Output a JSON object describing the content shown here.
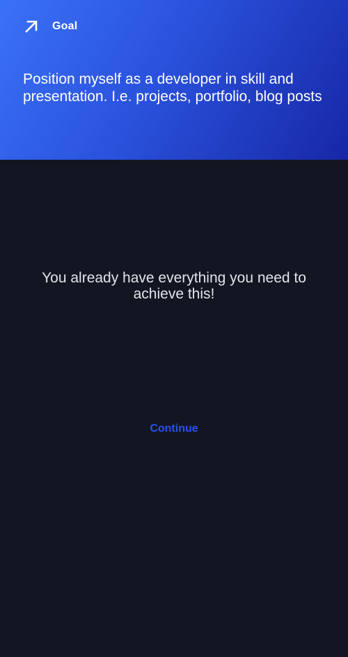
{
  "header": {
    "icon": "arrow-up-right-icon",
    "label": "Goal",
    "title": "Position myself as a developer in skill and presentation. I.e. projects, portfolio, blog posts",
    "gradient_colors": [
      "#3a72f7",
      "#2a52dc",
      "#1727a6"
    ]
  },
  "main": {
    "message": "You already have everything you need to achieve this!",
    "continue_label": "Continue",
    "background_color": "#131622",
    "accent_color": "#2a4ff0"
  }
}
